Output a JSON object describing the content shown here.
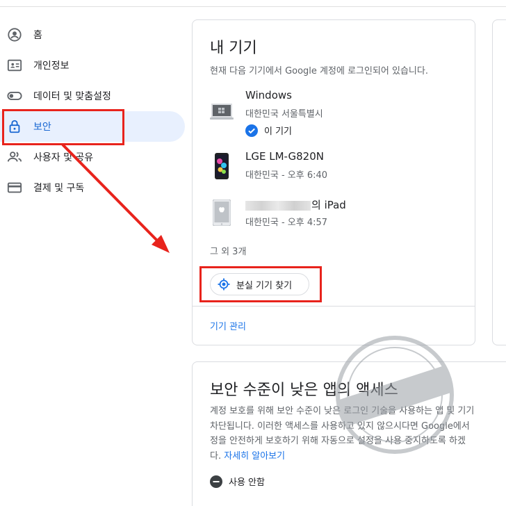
{
  "sidebar": {
    "items": [
      {
        "label": "홈",
        "icon": "account-circle-icon"
      },
      {
        "label": "개인정보",
        "icon": "id-card-icon"
      },
      {
        "label": "데이터 및 맞춤설정",
        "icon": "toggle-icon"
      },
      {
        "label": "보안",
        "icon": "lock-icon",
        "active": true
      },
      {
        "label": "사용자 및 공유",
        "icon": "people-icon"
      },
      {
        "label": "결제 및 구독",
        "icon": "credit-card-icon"
      }
    ]
  },
  "devices_card": {
    "title": "내 기기",
    "subtitle": "현재 다음 기기에서 Google 계정에 로그인되어 있습니다.",
    "devices": [
      {
        "name": "Windows",
        "location": "대한민국 서울특별시",
        "this_device": "이 기기",
        "icon": "laptop-icon"
      },
      {
        "name": "LGE LM-G820N",
        "location": "대한민국 - 오후 6:40",
        "icon": "phone-icon"
      },
      {
        "name_suffix": "의 iPad",
        "location": "대한민국 - 오후 4:57",
        "icon": "tablet-icon"
      }
    ],
    "more": "그 외 3개",
    "find_button": "분실 기기 찾기",
    "manage_link": "기기 관리"
  },
  "apps_card": {
    "title": "보안 수준이 낮은 앱의 액세스",
    "description_lines": [
      "계정 보호를 위해 보안 수준이 낮은 로그인 기술을 사용하는 앱 및 기기",
      "차단됩니다. 이러한 액세스를 사용하고 있지 않으시다면 Google에서",
      "정을 안전하게 보호하기 위해 자동으로 설정을 사용 중지하도록 하겠"
    ],
    "description_last_prefix": "다. ",
    "learn_more": "자세히 알아보기",
    "status": "사용 안함"
  },
  "colors": {
    "accent": "#1a73e8",
    "active_bg": "#e8f0fe",
    "highlight": "#e8231c"
  }
}
